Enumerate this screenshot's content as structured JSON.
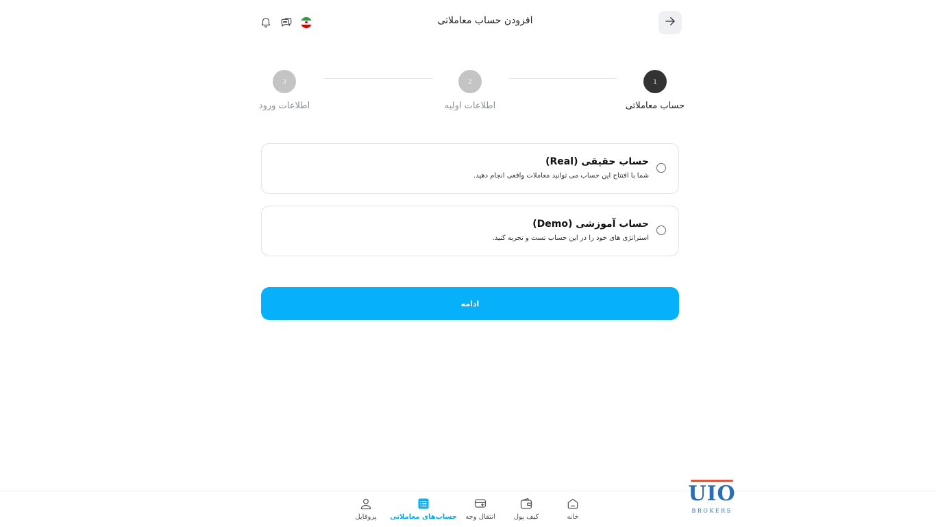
{
  "header": {
    "title": "افزودن حساب معاملاتی",
    "back_icon": "arrow-right-icon",
    "icons": [
      "iran-flag-icon",
      "chat-icon",
      "bell-icon"
    ]
  },
  "stepper": {
    "steps": [
      {
        "number": "1",
        "label": "حساب معاملاتی",
        "state": "active",
        "color": "#333333"
      },
      {
        "number": "2",
        "label": "اطلاعات اولیه",
        "state": "pending",
        "color": "#c4c4c4"
      },
      {
        "number": "3",
        "label": "اطلاعات ورود",
        "state": "pending",
        "color": "#c4c4c4"
      }
    ]
  },
  "options": [
    {
      "title": "حساب حقیقی (Real)",
      "description": "شما با افتتاح این حساب می توانید معاملات واقعی انجام دهید.",
      "selected": false
    },
    {
      "title": "حساب آموزشی (Demo)",
      "description": "استراتژی های خود را در این حساب تست و تجربه کنید.",
      "selected": false
    }
  ],
  "continue_label": "ادامه",
  "bottom_nav": [
    {
      "label": "خانه",
      "icon": "home-icon",
      "active": false
    },
    {
      "label": "کیف پول",
      "icon": "wallet-icon",
      "active": false
    },
    {
      "label": "انتقال وجه",
      "icon": "card-transfer-icon",
      "active": false
    },
    {
      "label": "حساب‌های معاملاتی",
      "icon": "list-icon",
      "active": true
    },
    {
      "label": "پروفایل",
      "icon": "user-icon",
      "active": false
    }
  ],
  "logo": {
    "text": "UIO",
    "subtext": "BROKERS"
  },
  "colors": {
    "accent": "#06b0fb",
    "active_step": "#333333",
    "pending_step": "#c4c4c4"
  }
}
